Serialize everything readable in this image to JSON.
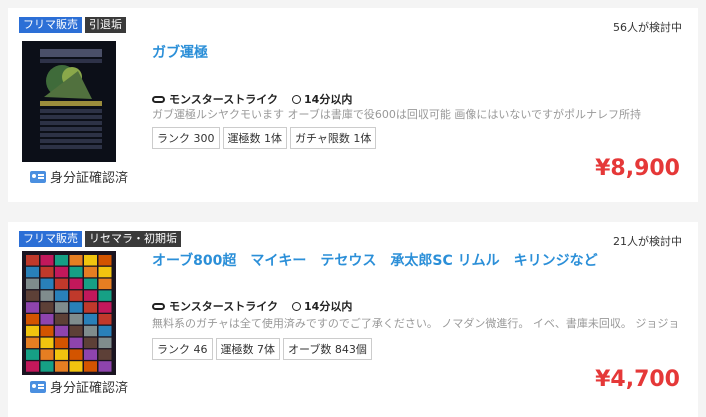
{
  "listings": [
    {
      "tags": [
        "フリマ販売",
        "引退垢"
      ],
      "watchers": "56人が検討中",
      "title": "ガブ運極",
      "game": "モンスターストライク",
      "delivery": "14分以内",
      "description": "ガブ運極ルシヤクモいます オーブは書庫で役600は回収可能 画像にはいないですがポルナレフ所持",
      "specs": [
        "ランク 300",
        "運極数 1体",
        "ガチャ限数 1体"
      ],
      "price": "¥8,900",
      "verified": "身分証確認済"
    },
    {
      "tags": [
        "フリマ販売",
        "リセマラ・初期垢"
      ],
      "watchers": "21人が検討中",
      "title": "オーブ800超　マイキー　テセウス　承太郎SC リムル　キリンジなど",
      "game": "モンスターストライク",
      "delivery": "14分以内",
      "description": "無料系のガチャは全て使用済みですのでご了承ください。 ノマダン微進行。 イベ、書庫未回収。 ジョジョ",
      "specs": [
        "ランク 46",
        "運極数 7体",
        "オーブ数 843個"
      ],
      "price": "¥4,700",
      "verified": "身分証確認済"
    }
  ],
  "colors": {
    "accent_blue": "#2b8fd8",
    "price_red": "#e53838",
    "tag_blue": "#2c6fd6",
    "tag_dark": "#3a3a3a"
  }
}
